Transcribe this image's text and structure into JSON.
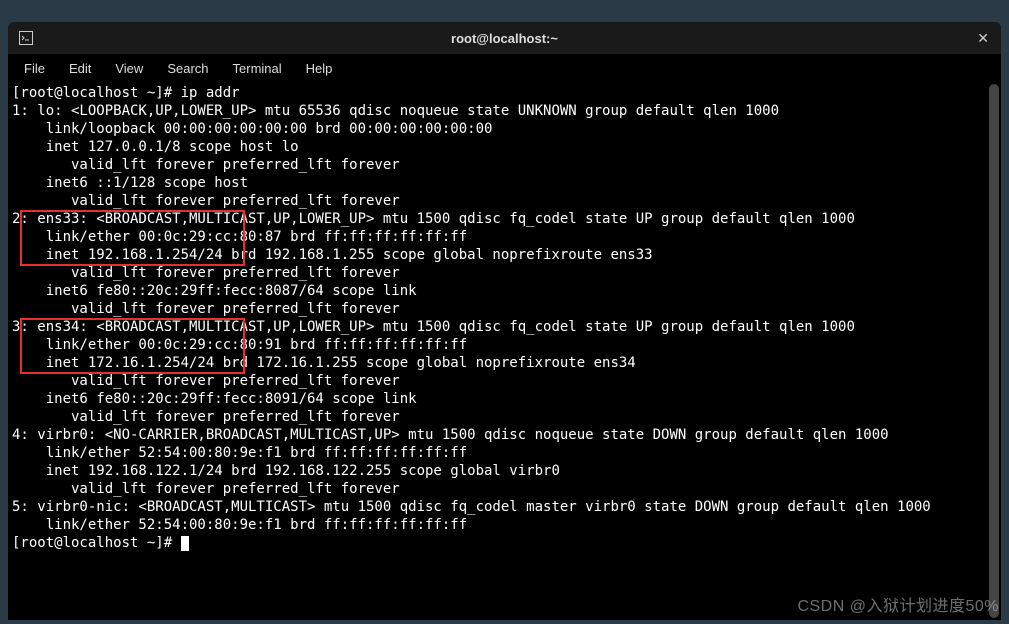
{
  "titlebar": {
    "title": "root@localhost:~",
    "close": "✕"
  },
  "menu": {
    "file": "File",
    "edit": "Edit",
    "view": "View",
    "search": "Search",
    "terminal": "Terminal",
    "help": "Help"
  },
  "terminal": {
    "prompt1": "[root@localhost ~]# ip addr",
    "lo_1": "1: lo: <LOOPBACK,UP,LOWER_UP> mtu 65536 qdisc noqueue state UNKNOWN group default qlen 1000",
    "lo_2": "    link/loopback 00:00:00:00:00:00 brd 00:00:00:00:00:00",
    "lo_3": "    inet 127.0.0.1/8 scope host lo",
    "lo_4": "       valid_lft forever preferred_lft forever",
    "lo_5": "    inet6 ::1/128 scope host ",
    "lo_6": "       valid_lft forever preferred_lft forever",
    "e33_1": "2: ens33: <BROADCAST,MULTICAST,UP,LOWER_UP> mtu 1500 qdisc fq_codel state UP group default qlen 1000",
    "e33_2": "    link/ether 00:0c:29:cc:80:87 brd ff:ff:ff:ff:ff:ff",
    "e33_3": "    inet 192.168.1.254/24 brd 192.168.1.255 scope global noprefixroute ens33",
    "e33_4": "       valid_lft forever preferred_lft forever",
    "e33_5": "    inet6 fe80::20c:29ff:fecc:8087/64 scope link ",
    "e33_6": "       valid_lft forever preferred_lft forever",
    "e34_1": "3: ens34: <BROADCAST,MULTICAST,UP,LOWER_UP> mtu 1500 qdisc fq_codel state UP group default qlen 1000",
    "e34_2": "    link/ether 00:0c:29:cc:80:91 brd ff:ff:ff:ff:ff:ff",
    "e34_3": "    inet 172.16.1.254/24 brd 172.16.1.255 scope global noprefixroute ens34",
    "e34_4": "       valid_lft forever preferred_lft forever",
    "e34_5": "    inet6 fe80::20c:29ff:fecc:8091/64 scope link ",
    "e34_6": "       valid_lft forever preferred_lft forever",
    "vb0_1": "4: virbr0: <NO-CARRIER,BROADCAST,MULTICAST,UP> mtu 1500 qdisc noqueue state DOWN group default qlen 1000",
    "vb0_2": "    link/ether 52:54:00:80:9e:f1 brd ff:ff:ff:ff:ff:ff",
    "vb0_3": "    inet 192.168.122.1/24 brd 192.168.122.255 scope global virbr0",
    "vb0_4": "       valid_lft forever preferred_lft forever",
    "vbn_1": "5: virbr0-nic: <BROADCAST,MULTICAST> mtu 1500 qdisc fq_codel master virbr0 state DOWN group default qlen 1000",
    "vbn_2": "    link/ether 52:54:00:80:9e:f1 brd ff:ff:ff:ff:ff:ff",
    "prompt2": "[root@localhost ~]# "
  },
  "watermark": "CSDN @入狱计划进度50%"
}
